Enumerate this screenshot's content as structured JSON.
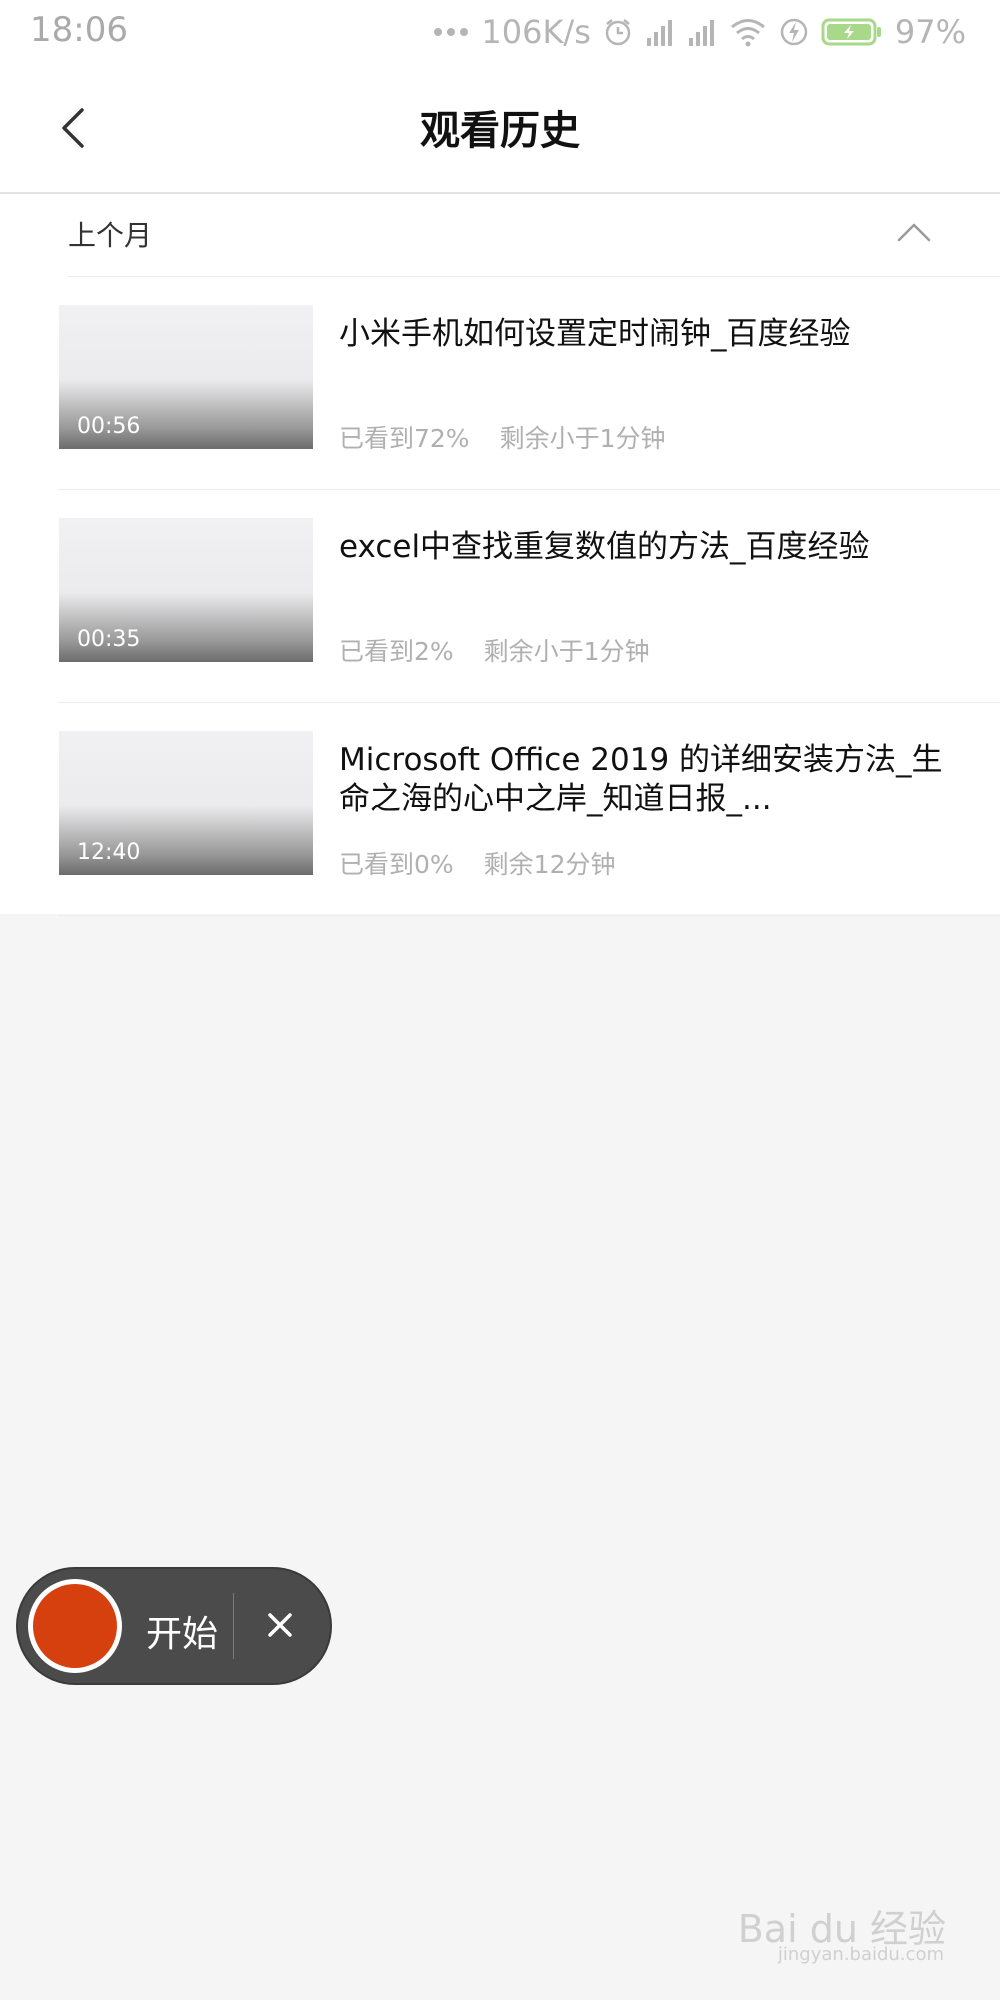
{
  "status_bar": {
    "time": "18:06",
    "network_speed": "106K/s",
    "battery": "97%",
    "icons": [
      "more-dots-icon",
      "alarm-icon",
      "signal-icon",
      "signal-icon",
      "wifi-icon",
      "charging-icon",
      "battery-icon"
    ]
  },
  "header": {
    "title": "观看历史",
    "back_icon": "chevron-left-icon"
  },
  "section": {
    "title": "上个月",
    "toggle_icon": "chevron-up-icon"
  },
  "items": [
    {
      "title": "小米手机如何设置定时闹钟_百度经验",
      "duration": "00:56",
      "watched": "已看到72%",
      "remaining": "剩余小于1分钟"
    },
    {
      "title": "excel中查找重复数值的方法_百度经验",
      "duration": "00:35",
      "watched": "已看到2%",
      "remaining": "剩余小于1分钟"
    },
    {
      "title": "Microsoft Office 2019 的详细安装方法_生命之海的心中之岸_知道日报_...",
      "duration": "12:40",
      "watched": "已看到0%",
      "remaining": "剩余12分钟"
    }
  ],
  "recorder": {
    "start_label": "开始",
    "close_icon": "close-icon",
    "accent_color": "#d6400f"
  },
  "watermark": {
    "text": "Bai du 经验",
    "sub": "jingyan.baidu.com"
  }
}
